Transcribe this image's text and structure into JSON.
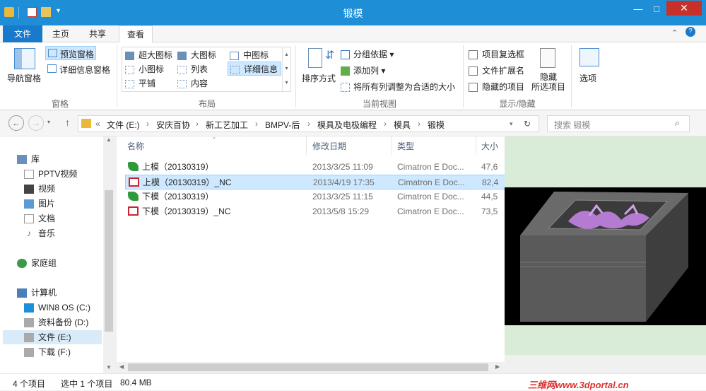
{
  "window": {
    "title": "锻模"
  },
  "tabs": {
    "file": "文件",
    "home": "主页",
    "share": "共享",
    "view": "查看"
  },
  "ribbon": {
    "pane": {
      "nav_pane": "导航窗格",
      "preview_pane": "预览窗格",
      "details_pane": "详细信息窗格",
      "label": "窗格"
    },
    "layout": {
      "extra_large": "超大图标",
      "large": "大图标",
      "medium": "中图标",
      "small": "小图标",
      "list": "列表",
      "details": "详细信息",
      "tiles": "平铺",
      "content": "内容",
      "label": "布局"
    },
    "current_view": {
      "sort_by": "排序方式",
      "group_by": "分组依据",
      "add_columns": "添加列",
      "size_all_columns": "将所有列调整为合适的大小",
      "label": "当前视图"
    },
    "show_hide": {
      "item_checkboxes": "项目复选框",
      "file_extensions": "文件扩展名",
      "hidden_items": "隐藏的项目",
      "hide_selected": "隐藏\n所选项目",
      "label": "显示/隐藏"
    },
    "options": "选项"
  },
  "address": {
    "prefix": "«",
    "crumbs": [
      "文件 (E:)",
      "安庆百协",
      "新工艺加工",
      "BMPV-后",
      "模具及电极编程",
      "模具",
      "锻模"
    ],
    "search_placeholder": "搜索 锻模"
  },
  "nav": {
    "library": "库",
    "pptv": "PPTV视频",
    "video": "视频",
    "pictures": "图片",
    "documents": "文档",
    "music": "音乐",
    "homegroup": "家庭组",
    "computer": "计算机",
    "drive_c": "WIN8 OS (C:)",
    "drive_d": "资料备份 (D:)",
    "drive_e": "文件 (E:)",
    "drive_f": "下载 (F:)"
  },
  "columns": {
    "name": "名称",
    "modified": "修改日期",
    "type": "类型",
    "size": "大小"
  },
  "files": [
    {
      "name": "上模（20130319）",
      "modified": "2013/3/25 11:09",
      "type": "Cimatron E Doc...",
      "size": "47,6",
      "icon": "cimatron-part-icon",
      "selected": false
    },
    {
      "name": "上模（20130319）_NC",
      "modified": "2013/4/19 17:35",
      "type": "Cimatron E Doc...",
      "size": "82,4",
      "icon": "cimatron-nc-icon",
      "selected": true
    },
    {
      "name": "下模（20130319）",
      "modified": "2013/3/25 11:15",
      "type": "Cimatron E Doc...",
      "size": "44,5",
      "icon": "cimatron-part-icon",
      "selected": false
    },
    {
      "name": "下模（20130319）_NC",
      "modified": "2013/5/8 15:29",
      "type": "Cimatron E Doc...",
      "size": "73,5",
      "icon": "cimatron-nc-icon",
      "selected": false
    }
  ],
  "status": {
    "count": "4 个项目",
    "selected": "选中 1 个项目",
    "size": "80.4 MB",
    "watermark": "三维网www.3dportal.cn"
  },
  "colors": {
    "titlebar": "#1e8fd6",
    "file_tab": "#1979ca",
    "selection": "#cde8ff"
  }
}
